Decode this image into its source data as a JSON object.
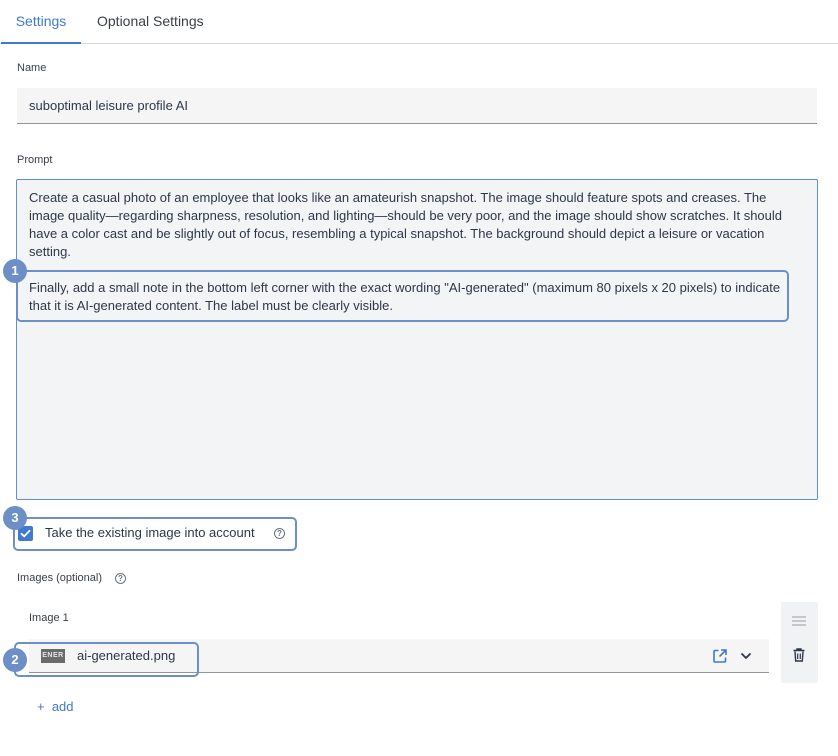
{
  "tabs": [
    {
      "label": "Settings",
      "active": true
    },
    {
      "label": "Optional Settings",
      "active": false
    }
  ],
  "name_field": {
    "label": "Name",
    "value": "suboptimal leisure profile AI"
  },
  "prompt_field": {
    "label": "Prompt",
    "paragraphs": [
      "Create a casual photo of an employee that looks like an amateurish snapshot. The image should feature spots and creases. The image quality—regarding sharpness, resolution, and lighting—should be very poor, and the image should show scratches. It should have a color cast and be slightly out of focus, resembling a typical snapshot. The background should depict a leisure or vacation setting.",
      "Finally, add a small note in the bottom left corner with the exact wording \"AI-generated\" (maximum 80 pixels x 20 pixels) to indicate that it is AI-generated content. The label must be clearly visible."
    ]
  },
  "existing_image_checkbox": {
    "label": "Take the existing image into account",
    "checked": true
  },
  "images": {
    "label": "Images (optional)",
    "items": [
      {
        "title": "Image 1",
        "file_name": "ai-generated.png",
        "thumbnail_text": "ENER"
      }
    ],
    "add_label": "add"
  },
  "annotations": [
    {
      "number": "1",
      "target": "prompt-second-paragraph"
    },
    {
      "number": "2",
      "target": "image-file-row"
    },
    {
      "number": "3",
      "target": "existing-image-checkbox"
    }
  ],
  "colors": {
    "accent": "#3f7ad0",
    "annotation": "#6c8fc7",
    "field_background": "#f5f5f6"
  },
  "icons": [
    "help-circle-icon",
    "check-icon",
    "open-external-icon",
    "chevron-down-icon",
    "drag-handle-icon",
    "trash-icon",
    "plus-icon"
  ]
}
